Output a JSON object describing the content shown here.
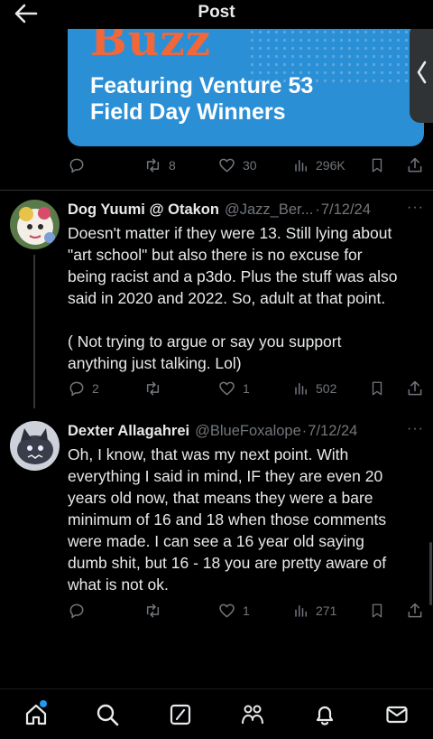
{
  "header": {
    "title": "Post",
    "back_icon": "arrow-left-icon"
  },
  "media_card": {
    "brand": "Buzz",
    "headline_line1": "Featuring Venture 53",
    "headline_line2": "Field Day Winners",
    "background_color": "#2b8fd6",
    "brand_color": "#f2673a"
  },
  "main_actions": {
    "reposts": "8",
    "likes": "30",
    "views": "296K"
  },
  "replies": [
    {
      "name": "Dog Yuumi @ Otakon",
      "handle": "@Jazz_Ber...",
      "date": "7/12/24",
      "lines": [
        "Doesn't matter if they were 13. Still lying about",
        "\"art school\" but also there is no excuse for",
        "being racist and a p3do. Plus the stuff was also",
        "said in 2020 and 2022. So, adult at that point.",
        "( Not trying to argue or say you support",
        "anything just talking. Lol)"
      ],
      "replies_count": "2",
      "likes": "1",
      "views": "502"
    },
    {
      "name": "Dexter Allagahrei",
      "handle": "@BlueFoxalope",
      "date": "7/12/24",
      "lines": [
        "Oh, I know, that was my next point. With",
        "everything I said in mind, IF they are even 20",
        "years old now, that means they were a bare",
        "minimum of 16 and 18 when those comments",
        "were made. I can see a 16 year old saying",
        "dumb shit, but 16 - 18 you are pretty aware of",
        "what is not ok."
      ],
      "likes": "1",
      "views": "271"
    }
  ],
  "separator": "·",
  "more_label": "···",
  "bottom_nav": [
    "home-icon",
    "search-icon",
    "grok-icon",
    "communities-icon",
    "notifications-icon",
    "messages-icon"
  ],
  "colors": {
    "accent": "#1d9bf0",
    "muted": "#71767b",
    "text": "#e7e9ea",
    "background": "#000000"
  }
}
